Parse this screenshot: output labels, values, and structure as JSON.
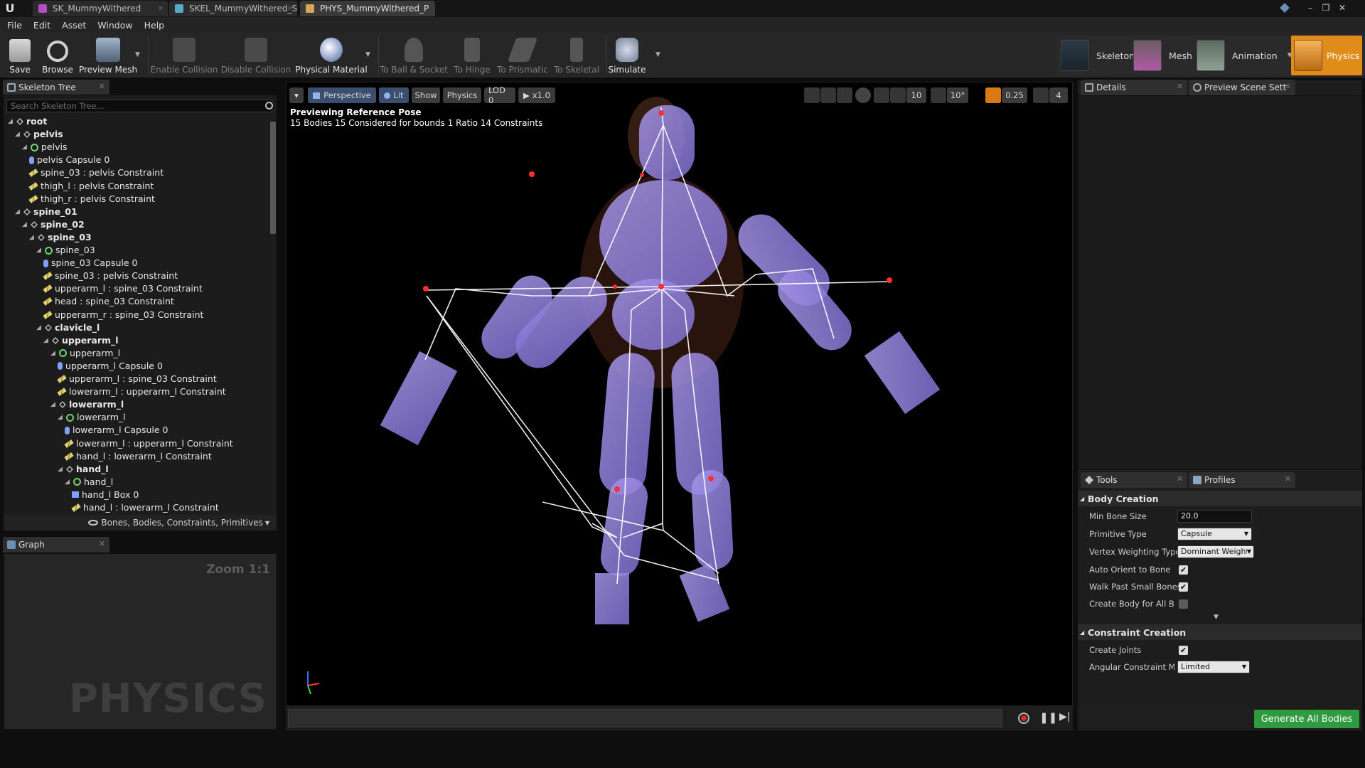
{
  "doc_tabs": [
    {
      "label": "SK_MummyWithered",
      "color": "#b34fc2"
    },
    {
      "label": "SKEL_MummyWithered_Sk",
      "color": "#5aa9c9"
    },
    {
      "label": "PHYS_MummyWithered_P",
      "color": "#d6a657"
    }
  ],
  "menu": [
    "File",
    "Edit",
    "Asset",
    "Window",
    "Help"
  ],
  "toolbar": {
    "save": "Save",
    "browse": "Browse",
    "preview_mesh": "Preview Mesh",
    "enable_collision": "Enable Collision",
    "disable_collision": "Disable Collision",
    "physical_material": "Physical Material",
    "to_ball_socket": "To Ball & Socket",
    "to_hinge": "To Hinge",
    "to_prismatic": "To Prismatic",
    "to_skeletal": "To Skeletal",
    "simulate": "Simulate"
  },
  "modes": {
    "skeleton": "Skeleton",
    "mesh": "Mesh",
    "animation": "Animation",
    "physics": "Physics",
    "active": "Physics"
  },
  "skeleton_tree": {
    "tab": "Skeleton Tree",
    "search_placeholder": "Search Skeleton Tree...",
    "rows": [
      {
        "text": "root",
        "kind": "bone",
        "bold": true
      },
      {
        "text": "pelvis",
        "kind": "bone",
        "bold": true
      },
      {
        "text": "pelvis",
        "kind": "body",
        "bold": false
      },
      {
        "text": "pelvis Capsule 0",
        "kind": "cap",
        "bold": false
      },
      {
        "text": "spine_03 : pelvis Constraint",
        "kind": "con",
        "bold": false
      },
      {
        "text": "thigh_l : pelvis Constraint",
        "kind": "con",
        "bold": false
      },
      {
        "text": "thigh_r : pelvis Constraint",
        "kind": "con",
        "bold": false
      },
      {
        "text": "spine_01",
        "kind": "bone",
        "bold": true
      },
      {
        "text": "spine_02",
        "kind": "bone",
        "bold": true
      },
      {
        "text": "spine_03",
        "kind": "bone",
        "bold": true
      },
      {
        "text": "spine_03",
        "kind": "body",
        "bold": false
      },
      {
        "text": "spine_03 Capsule 0",
        "kind": "cap",
        "bold": false
      },
      {
        "text": "spine_03 : pelvis Constraint",
        "kind": "con",
        "bold": false
      },
      {
        "text": "upperarm_l : spine_03 Constraint",
        "kind": "con",
        "bold": false
      },
      {
        "text": "head : spine_03 Constraint",
        "kind": "con",
        "bold": false
      },
      {
        "text": "upperarm_r : spine_03 Constraint",
        "kind": "con",
        "bold": false
      },
      {
        "text": "clavicle_l",
        "kind": "bone",
        "bold": true
      },
      {
        "text": "upperarm_l",
        "kind": "bone",
        "bold": true
      },
      {
        "text": "upperarm_l",
        "kind": "body",
        "bold": false
      },
      {
        "text": "upperarm_l Capsule 0",
        "kind": "cap",
        "bold": false
      },
      {
        "text": "upperarm_l : spine_03 Constraint",
        "kind": "con",
        "bold": false
      },
      {
        "text": "lowerarm_l : upperarm_l Constraint",
        "kind": "con",
        "bold": false
      },
      {
        "text": "lowerarm_l",
        "kind": "bone",
        "bold": true
      },
      {
        "text": "lowerarm_l",
        "kind": "body",
        "bold": false
      },
      {
        "text": "lowerarm_l Capsule 0",
        "kind": "cap",
        "bold": false
      },
      {
        "text": "lowerarm_l : upperarm_l Constraint",
        "kind": "con",
        "bold": false
      },
      {
        "text": "hand_l : lowerarm_l Constraint",
        "kind": "con",
        "bold": false
      },
      {
        "text": "hand_l",
        "kind": "bone",
        "bold": true
      },
      {
        "text": "hand_l",
        "kind": "body",
        "bold": false
      },
      {
        "text": "hand_l Box 0",
        "kind": "box",
        "bold": false
      },
      {
        "text": "hand_l : lowerarm_l Constraint",
        "kind": "con",
        "bold": false
      }
    ],
    "filter": "Bones, Bodies, Constraints, Primitives"
  },
  "graph": {
    "tab": "Graph",
    "zoom": "Zoom 1:1",
    "watermark": "PHYSICS"
  },
  "viewport": {
    "perspective": "Perspective",
    "lit": "Lit",
    "show": "Show",
    "physics": "Physics",
    "lod": "LOD 0",
    "speed": "x1.0",
    "grid_snap": "10",
    "rot_snap": "10°",
    "scale_snap": "0.25",
    "cam_speed": "4",
    "info_line1": "Previewing Reference Pose",
    "info_line2": "15 Bodies  15 Considered for bounds  1 Ratio  14 Constraints"
  },
  "details": {
    "tab1": "Details",
    "tab2": "Preview Scene Sett"
  },
  "tools": {
    "tab1": "Tools",
    "tab2": "Profiles",
    "body_creation": "Body Creation",
    "min_bone_size_label": "Min Bone Size",
    "min_bone_size": "20.0",
    "primitive_type_label": "Primitive Type",
    "primitive_type": "Capsule",
    "vertex_weighting_label": "Vertex Weighting Type",
    "vertex_weighting": "Dominant Weight",
    "auto_orient_label": "Auto Orient to Bone",
    "auto_orient": true,
    "walk_past_label": "Walk Past Small Bones",
    "walk_past": true,
    "create_body_all_label": "Create Body for All Bone",
    "create_body_all": false,
    "constraint_creation": "Constraint Creation",
    "create_joints_label": "Create Joints",
    "create_joints": true,
    "angular_mode_label": "Angular Constraint Mod",
    "angular_mode": "Limited",
    "generate": "Generate All Bodies"
  }
}
